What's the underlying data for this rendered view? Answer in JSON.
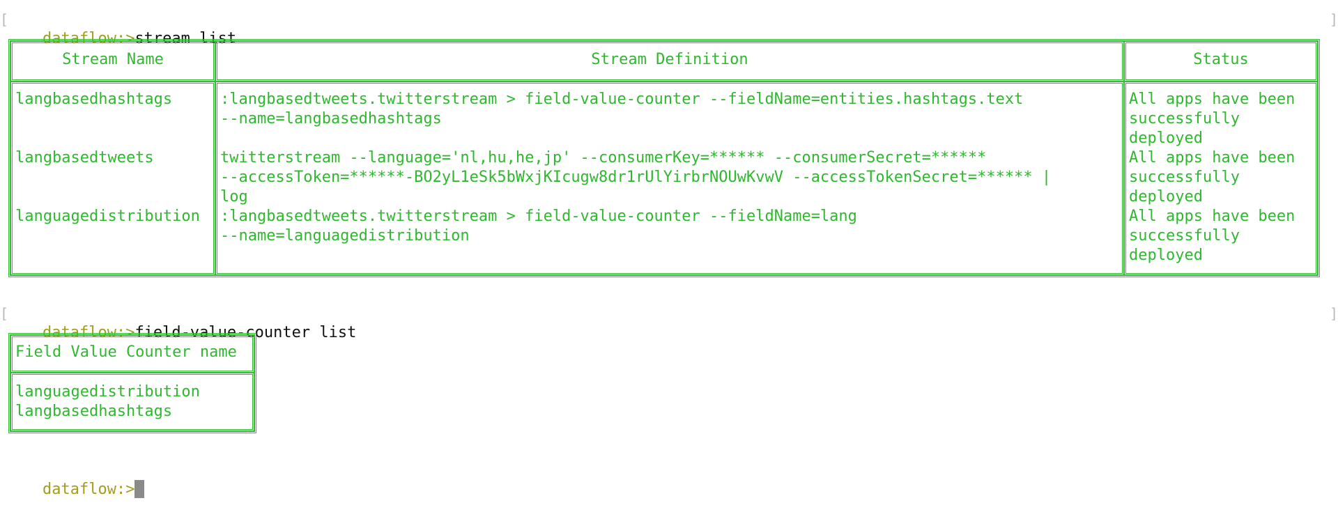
{
  "prompt": "dataflow:>",
  "commands": {
    "first": "stream list",
    "second": "field-value-counter list"
  },
  "bracket_open": "[",
  "bracket_close": "]",
  "stream_table": {
    "headers": [
      "Stream Name",
      "Stream Definition",
      "Status"
    ],
    "rows": [
      {
        "name": "langbasedhashtags",
        "definition": [
          ":langbasedtweets.twitterstream > field-value-counter --fieldName=entities.hashtags.text",
          "--name=langbasedhashtags"
        ],
        "status": [
          "All apps have been",
          "successfully",
          "deployed"
        ]
      },
      {
        "name": "langbasedtweets",
        "definition": [
          "twitterstream --language='nl,hu,he,jp' --consumerKey=****** --consumerSecret=******",
          "--accessToken=******-BO2yL1eSk5bWxjKIcugw8dr1rUlYirbrNOUwKvwV --accessTokenSecret=****** |",
          "log"
        ],
        "status": [
          "All apps have been",
          "successfully",
          "deployed"
        ]
      },
      {
        "name": "languagedistribution",
        "definition": [
          ":langbasedtweets.twitterstream > field-value-counter --fieldName=lang",
          "--name=languagedistribution"
        ],
        "status": [
          "All apps have been",
          "successfully",
          "deployed"
        ]
      }
    ]
  },
  "fvc_table": {
    "header": "Field Value Counter name",
    "rows": [
      "languagedistribution",
      "langbasedhashtags"
    ]
  },
  "colors": {
    "prompt": "#a59c1e",
    "green": "#2fb82f",
    "command": "#111111"
  }
}
